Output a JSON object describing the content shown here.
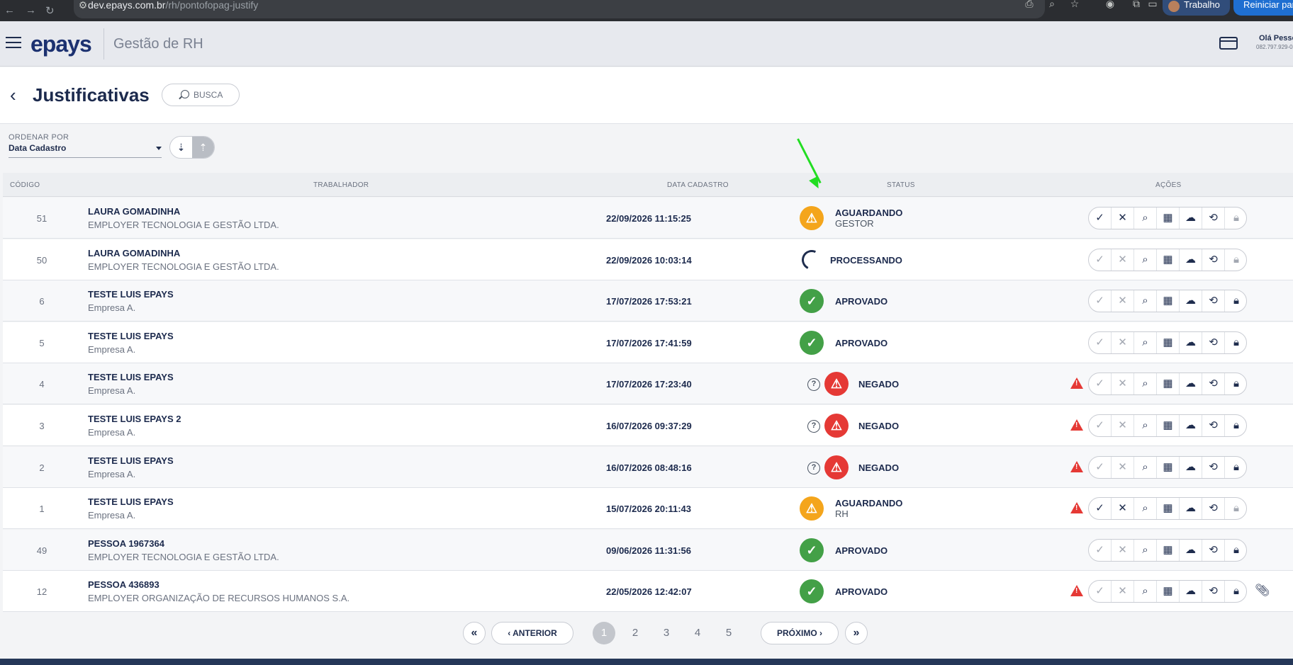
{
  "browser": {
    "url_domain": "dev.epays.com.br",
    "url_path": "/rh/pontofopag-justify",
    "profile": "Trabalho",
    "restart": "Reiniciar para"
  },
  "app": {
    "logo": "epays",
    "name": "Gestão de RH",
    "greeting": "Olá Pesso",
    "user_doc": "082.797.929-0"
  },
  "page": {
    "title": "Justificativas",
    "search_label": "BUSCA"
  },
  "order": {
    "label": "ORDENAR POR",
    "value": "Data Cadastro"
  },
  "table": {
    "headers": {
      "code": "CÓDIGO",
      "worker": "TRABALHADOR",
      "date": "DATA CADASTRO",
      "status": "STATUS",
      "actions": "AÇÕES"
    },
    "rows": [
      {
        "code": "51",
        "name": "LAURA GOMADINHA",
        "company": "EMPLOYER TECNOLOGIA E GESTÃO LTDA.",
        "date": "22/09/2026 11:15:25",
        "status": "AGUARDANDO",
        "status_sub": "GESTOR",
        "status_kind": "pending"
      },
      {
        "code": "50",
        "name": "LAURA GOMADINHA",
        "company": "EMPLOYER TECNOLOGIA E GESTÃO LTDA.",
        "date": "22/09/2026 10:03:14",
        "status": "PROCESSANDO",
        "status_sub": "",
        "status_kind": "processing"
      },
      {
        "code": "6",
        "name": "TESTE LUIS EPAYS",
        "company": "Empresa A.",
        "date": "17/07/2026 17:53:21",
        "status": "APROVADO",
        "status_sub": "",
        "status_kind": "approved"
      },
      {
        "code": "5",
        "name": "TESTE LUIS EPAYS",
        "company": "Empresa A.",
        "date": "17/07/2026 17:41:59",
        "status": "APROVADO",
        "status_sub": "",
        "status_kind": "approved"
      },
      {
        "code": "4",
        "name": "TESTE LUIS EPAYS",
        "company": "Empresa A.",
        "date": "17/07/2026 17:23:40",
        "status": "NEGADO",
        "status_sub": "",
        "status_kind": "denied"
      },
      {
        "code": "3",
        "name": "TESTE LUIS EPAYS 2",
        "company": "Empresa A.",
        "date": "16/07/2026 09:37:29",
        "status": "NEGADO",
        "status_sub": "",
        "status_kind": "denied"
      },
      {
        "code": "2",
        "name": "TESTE LUIS EPAYS",
        "company": "Empresa A.",
        "date": "16/07/2026 08:48:16",
        "status": "NEGADO",
        "status_sub": "",
        "status_kind": "denied"
      },
      {
        "code": "1",
        "name": "TESTE LUIS EPAYS",
        "company": "Empresa A.",
        "date": "15/07/2026 20:11:43",
        "status": "AGUARDANDO",
        "status_sub": "RH",
        "status_kind": "pending"
      },
      {
        "code": "49",
        "name": "PESSOA 1967364",
        "company": "EMPLOYER TECNOLOGIA E GESTÃO LTDA.",
        "date": "09/06/2026 11:31:56",
        "status": "APROVADO",
        "status_sub": "",
        "status_kind": "approved"
      },
      {
        "code": "12",
        "name": "PESSOA 436893",
        "company": "EMPLOYER ORGANIZAÇÃO DE RECURSOS HUMANOS S.A.",
        "date": "22/05/2026 12:42:07",
        "status": "APROVADO",
        "status_sub": "",
        "status_kind": "approved"
      }
    ]
  },
  "pagination": {
    "prev": "ANTERIOR",
    "next": "PRÓXIMO",
    "pages": [
      "1",
      "2",
      "3",
      "4",
      "5"
    ],
    "current": "1"
  },
  "colors": {
    "pending": "#f4a51c",
    "approved": "#43a047",
    "denied": "#e53935",
    "navy": "#1c2a4d",
    "annotation_arrow": "#22dd22"
  }
}
